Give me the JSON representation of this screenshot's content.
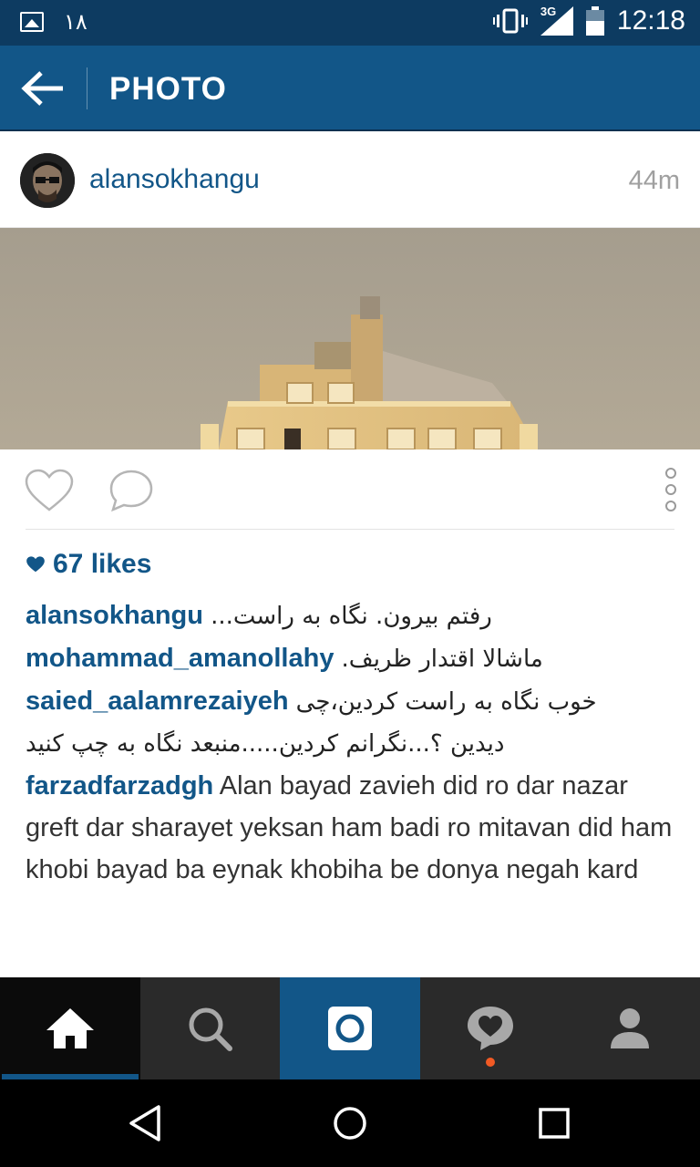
{
  "status_bar": {
    "notification_count": "۱۸",
    "network": "3G",
    "time": "12:18"
  },
  "app_bar": {
    "title": "PHOTO"
  },
  "post": {
    "username": "alansokhangu",
    "time_ago": "44m",
    "likes": "67 likes"
  },
  "comments": [
    {
      "author": "alansokhangu",
      "text": "رفتم بیرون. نگاه به راست...",
      "dir": "rtl"
    },
    {
      "author": "mohammad_amanollahy",
      "text": "ماشالا اقتدار ظریف.",
      "dir": "rtl"
    },
    {
      "author": "saied_aalamrezaiyeh",
      "text": "خوب نگاه به راست کردین،چی",
      "dir": "rtl",
      "continuation": "دیدین ؟...نگرانم کردین.....منبعد نگاه به چپ کنید"
    },
    {
      "author": "farzadfarzadgh",
      "text": "Alan bayad zavieh did ro dar nazar greft dar sharayet yeksan ham badi ro mitavan did ham khobi bayad ba eynak khobiha be donya negah kard",
      "dir": "ltr"
    }
  ],
  "tabs": [
    {
      "name": "home",
      "icon": "home-icon",
      "active": true
    },
    {
      "name": "search",
      "icon": "search-icon"
    },
    {
      "name": "camera",
      "icon": "camera-icon"
    },
    {
      "name": "activity",
      "icon": "heart-bubble-icon",
      "has_notification": true
    },
    {
      "name": "profile",
      "icon": "person-icon"
    }
  ],
  "colors": {
    "brand": "#125688",
    "status_bar": "#0d3b61",
    "notification_dot": "#f15a24"
  }
}
